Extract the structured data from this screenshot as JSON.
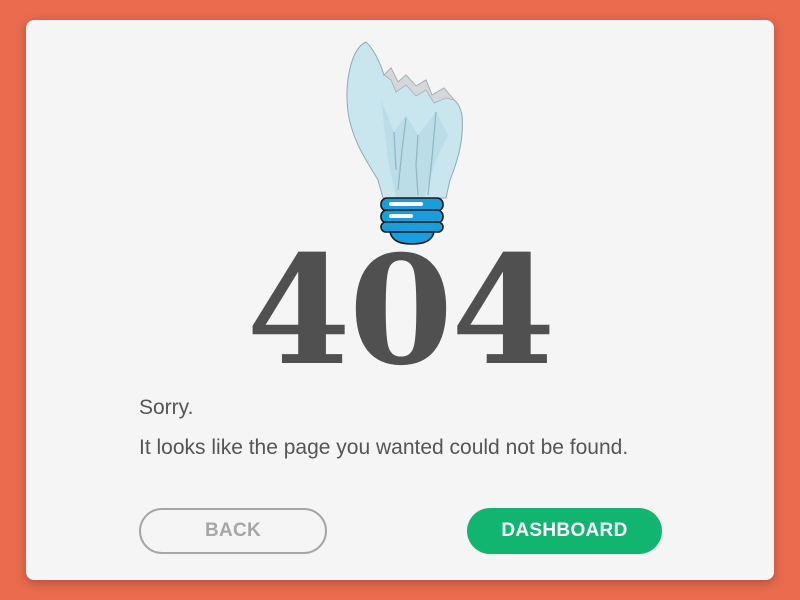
{
  "error": {
    "code": "404",
    "sorry": "Sorry.",
    "message": "It looks like the page you wanted could not be found."
  },
  "actions": {
    "back_label": "BACK",
    "dashboard_label": "DASHBOARD"
  },
  "colors": {
    "background": "#ea6b4d",
    "card": "#f5f5f5",
    "code_text": "#505050",
    "body_text": "#555555",
    "back_outline": "#a6a6a6",
    "dashboard_button": "#12b56f",
    "bulb_glass": "#c9e6ef",
    "bulb_base": "#1a9ddd"
  },
  "icons": {
    "illustration": "broken-lightbulb-icon"
  }
}
